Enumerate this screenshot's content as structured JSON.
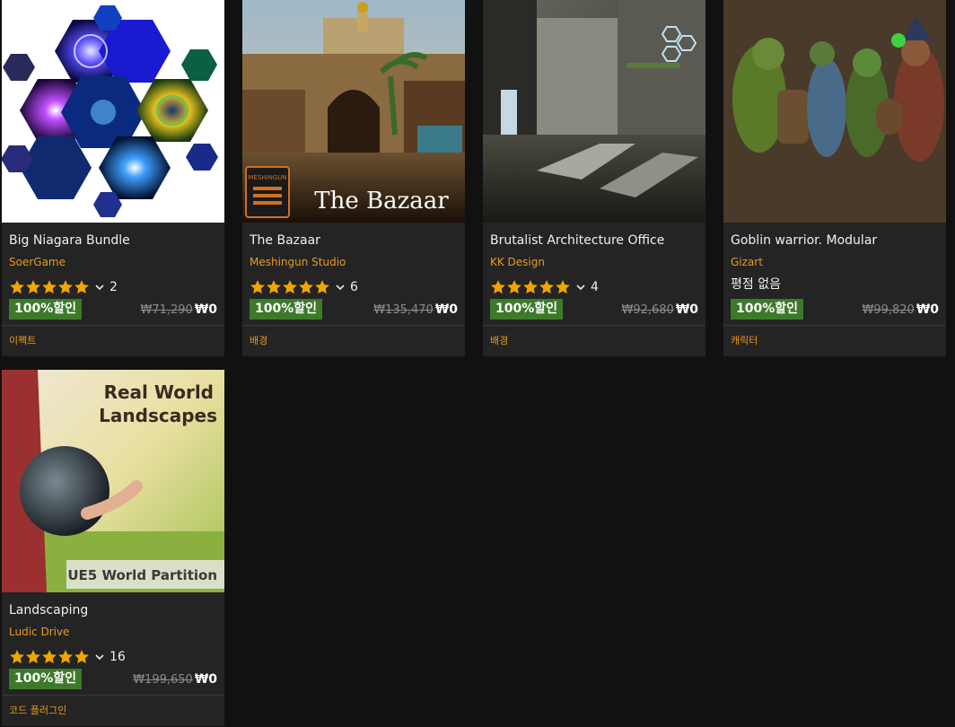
{
  "colors": {
    "background": "#111111",
    "card": "#242424",
    "accent": "#e89a1d",
    "badge": "#3c7a2a",
    "star": "#f0a500"
  },
  "products": [
    {
      "title": "Big Niagara Bundle",
      "seller": "SoerGame",
      "rating_stars": 5,
      "review_count": "2",
      "discount": "100%할인",
      "original_price": "₩71,290",
      "price": "₩0",
      "category": "이펙트"
    },
    {
      "title": "The Bazaar",
      "seller": "Meshingun Studio",
      "rating_stars": 5,
      "review_count": "6",
      "discount": "100%할인",
      "original_price": "₩135,470",
      "price": "₩0",
      "category": "배경",
      "thumb_text": "The Bazaar",
      "logo_text": "MESHINGUN"
    },
    {
      "title": "Brutalist Architecture Office",
      "seller": "KK Design",
      "rating_stars": 5,
      "review_count": "4",
      "discount": "100%할인",
      "original_price": "₩92,680",
      "price": "₩0",
      "category": "배경"
    },
    {
      "title": "Goblin warrior. Modular",
      "seller": "Gizart",
      "rating_text": "평점 없음",
      "discount": "100%할인",
      "original_price": "₩99,820",
      "price": "₩0",
      "category": "캐릭터"
    },
    {
      "title": "Landscaping",
      "seller": "Ludic Drive",
      "rating_stars": 5,
      "review_count": "16",
      "discount": "100%할인",
      "original_price": "₩199,650",
      "price": "₩0",
      "category": "코드 플러그인",
      "thumb_text_1": "Real World",
      "thumb_text_2": "Landscapes",
      "thumb_banner": "UE5 World Partition"
    }
  ]
}
